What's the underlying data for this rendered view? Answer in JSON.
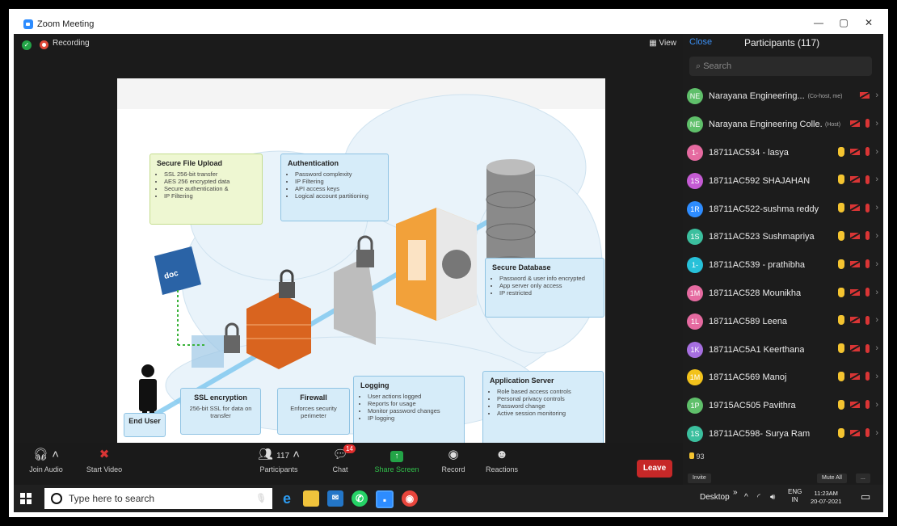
{
  "window": {
    "title": "Zoom Meeting",
    "controls": [
      "—",
      "▢",
      "✕"
    ]
  },
  "meeting": {
    "recording_label": "Recording",
    "view_label": "View"
  },
  "slide": {
    "secure_file_upload": {
      "title": "Secure File Upload",
      "items": [
        "SSL 256-bit transfer",
        "AES 256 encrypted data",
        "Secure authentication &",
        "IP Filtering"
      ]
    },
    "authentication": {
      "title": "Authentication",
      "items": [
        "Password complexity",
        "IP Filtering",
        "API access keys",
        "Logical account partitioning"
      ]
    },
    "secure_database": {
      "title": "Secure Database",
      "items": [
        "Password & user info encrypted",
        "App server only access",
        "IP restricted"
      ]
    },
    "ssl_encryption": {
      "title": "SSL encryption",
      "text": "256-bit SSL for data on transfer"
    },
    "firewall": {
      "title": "Firewall",
      "text": "Enforces security perimeter"
    },
    "logging": {
      "title": "Logging",
      "items": [
        "User actions logged",
        "Reports for usage",
        "Monitor password changes",
        "IP logging"
      ]
    },
    "application_server": {
      "title": "Application Server",
      "items": [
        "Role based access controls",
        "Personal privacy controls",
        "Password change",
        "Active session monitoring"
      ]
    },
    "end_user": "End User",
    "doc_label": "doc"
  },
  "controls": {
    "join_audio": "Join Audio",
    "start_video": "Start Video",
    "participants": "Participants",
    "participants_count": "117",
    "chat": "Chat",
    "chat_badge": "14",
    "share_screen": "Share Screen",
    "record": "Record",
    "reactions": "Reactions",
    "leave": "Leave"
  },
  "panel": {
    "close": "Close",
    "title": "Participants (117)",
    "search_placeholder": "Search",
    "participants": [
      {
        "initials": "NE",
        "color": "#5fbf6a",
        "name": "Narayana Engineering...",
        "role": "(Co-host, me)",
        "hand": false,
        "mic": false
      },
      {
        "initials": "NE",
        "color": "#5fbf6a",
        "name": "Narayana Engineering Colle...",
        "role": "(Host)",
        "hand": false,
        "mic": true
      },
      {
        "initials": "1-",
        "color": "#e56aa0",
        "name": "18711AC534 - lasya",
        "role": "",
        "hand": true,
        "mic": true
      },
      {
        "initials": "1S",
        "color": "#c45bd3",
        "name": "18711AC592 SHAJAHAN",
        "role": "",
        "hand": true,
        "mic": true
      },
      {
        "initials": "1R",
        "color": "#2d8cff",
        "name": "18711AC522-sushma reddy",
        "role": "",
        "hand": true,
        "mic": true
      },
      {
        "initials": "1S",
        "color": "#3bbf9e",
        "name": "18711AC523 Sushmapriya",
        "role": "",
        "hand": true,
        "mic": true
      },
      {
        "initials": "1-",
        "color": "#27c1d9",
        "name": "18711AC539 - prathibha",
        "role": "",
        "hand": true,
        "mic": true
      },
      {
        "initials": "1M",
        "color": "#e56aa0",
        "name": "18711AC528 Mounikha",
        "role": "",
        "hand": true,
        "mic": true
      },
      {
        "initials": "1L",
        "color": "#e56aa0",
        "name": "18711AC589 Leena",
        "role": "",
        "hand": true,
        "mic": true
      },
      {
        "initials": "1K",
        "color": "#a66fe0",
        "name": "18711AC5A1 Keerthana",
        "role": "",
        "hand": true,
        "mic": true
      },
      {
        "initials": "1M",
        "color": "#f2c21b",
        "name": "18711AC569 Manoj",
        "role": "",
        "hand": true,
        "mic": true
      },
      {
        "initials": "1P",
        "color": "#5fbf6a",
        "name": "19715AC505 Pavithra",
        "role": "",
        "hand": true,
        "mic": true
      },
      {
        "initials": "1S",
        "color": "#3bbf9e",
        "name": "18711AC598- Surya Ram",
        "role": "",
        "hand": true,
        "mic": true
      }
    ],
    "raised_hands": "93",
    "invite": "Invite",
    "mute_all": "Mute All",
    "more": "..."
  },
  "taskbar": {
    "search_placeholder": "Type here to search",
    "desktop": "Desktop",
    "chevron": "»",
    "lang_top": "ENG",
    "lang_bottom": "IN",
    "time": "11:23AM",
    "date": "20-07-2021"
  }
}
